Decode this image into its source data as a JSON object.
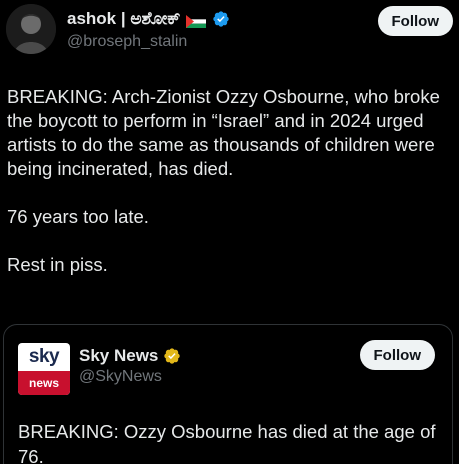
{
  "tweet": {
    "author": {
      "display_name": "ashok | ಅಶೋಕ್",
      "handle": "@broseph_stalin",
      "flag_icon": "palestine-flag-icon",
      "verified_icon": "blue-verified-icon",
      "verified_color": "#1d9bf0"
    },
    "follow_label": "Follow",
    "paragraphs": [
      "BREAKING: Arch-Zionist Ozzy Osbourne, who broke the boycott to perform in “Israel” and in 2024 urged artists to do the same as thousands of children were being incinerated, has died.",
      "76 years too late.",
      "Rest in piss."
    ]
  },
  "quoted_tweet": {
    "author": {
      "display_name": "Sky News",
      "handle": "@SkyNews",
      "logo_top": "sky",
      "logo_bottom": "news",
      "verified_icon": "gold-verified-icon",
      "verified_color": "#e2b719"
    },
    "follow_label": "Follow",
    "text": "BREAKING: Ozzy Osbourne has died at the age of 76."
  },
  "colors": {
    "background": "#000000",
    "text_primary": "#e7e9ea",
    "text_secondary": "#71767b",
    "border": "#2f3336",
    "button_bg": "#eff3f4",
    "sky_red": "#c8102e",
    "sky_navy": "#1b2a4e"
  }
}
